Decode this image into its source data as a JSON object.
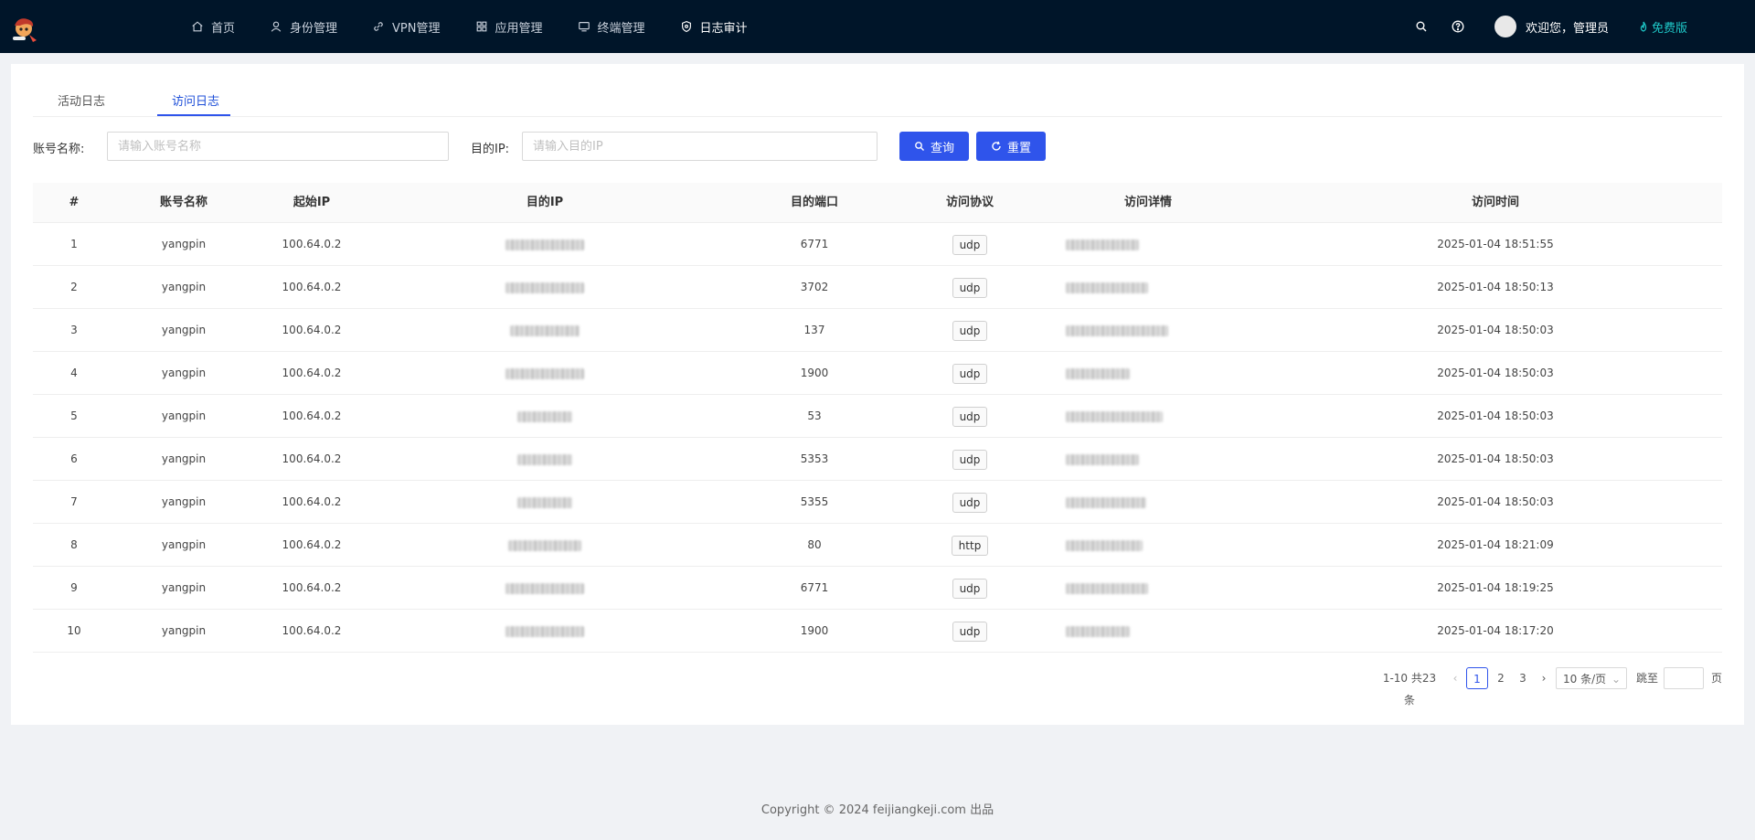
{
  "nav": {
    "items": [
      {
        "label": "首页",
        "icon": "home-icon"
      },
      {
        "label": "身份管理",
        "icon": "user-icon"
      },
      {
        "label": "VPN管理",
        "icon": "link-icon"
      },
      {
        "label": "应用管理",
        "icon": "apps-icon"
      },
      {
        "label": "终端管理",
        "icon": "monitor-icon"
      },
      {
        "label": "日志审计",
        "icon": "shield-icon",
        "active": true
      }
    ],
    "user_greeting": "欢迎您，管理员",
    "plan_label": "免费版"
  },
  "tabs": [
    "活动日志",
    "访问日志"
  ],
  "active_tab": "访问日志",
  "filters": {
    "account_label": "账号名称:",
    "account_placeholder": "请输入账号名称",
    "ip_label": "目的IP:",
    "ip_placeholder": "请输入目的IP",
    "search_label": "查询",
    "reset_label": "重置"
  },
  "table": {
    "columns": [
      "#",
      "账号名称",
      "起始IP",
      "目的IP",
      "目的端口",
      "访问协议",
      "访问详情",
      "访问时间"
    ],
    "rows": [
      {
        "no": "1",
        "account": "yangpin",
        "src": "100.64.0.2",
        "port": "6771",
        "proto": "udp",
        "time": "2025-01-04 18:51:55"
      },
      {
        "no": "2",
        "account": "yangpin",
        "src": "100.64.0.2",
        "port": "3702",
        "proto": "udp",
        "time": "2025-01-04 18:50:13"
      },
      {
        "no": "3",
        "account": "yangpin",
        "src": "100.64.0.2",
        "port": "137",
        "proto": "udp",
        "time": "2025-01-04 18:50:03"
      },
      {
        "no": "4",
        "account": "yangpin",
        "src": "100.64.0.2",
        "port": "1900",
        "proto": "udp",
        "time": "2025-01-04 18:50:03"
      },
      {
        "no": "5",
        "account": "yangpin",
        "src": "100.64.0.2",
        "port": "53",
        "proto": "udp",
        "time": "2025-01-04 18:50:03"
      },
      {
        "no": "6",
        "account": "yangpin",
        "src": "100.64.0.2",
        "port": "5353",
        "proto": "udp",
        "time": "2025-01-04 18:50:03"
      },
      {
        "no": "7",
        "account": "yangpin",
        "src": "100.64.0.2",
        "port": "5355",
        "proto": "udp",
        "time": "2025-01-04 18:50:03"
      },
      {
        "no": "8",
        "account": "yangpin",
        "src": "100.64.0.2",
        "port": "80",
        "proto": "http",
        "time": "2025-01-04 18:21:09"
      },
      {
        "no": "9",
        "account": "yangpin",
        "src": "100.64.0.2",
        "port": "6771",
        "proto": "udp",
        "time": "2025-01-04 18:19:25"
      },
      {
        "no": "10",
        "account": "yangpin",
        "src": "100.64.0.2",
        "port": "1900",
        "proto": "udp",
        "time": "2025-01-04 18:17:20"
      }
    ]
  },
  "pagination": {
    "summary": "1-10 共23条",
    "pages": [
      "1",
      "2",
      "3"
    ],
    "current": "1",
    "page_size": "10 条/页",
    "jump_label": "跳至",
    "page_suffix": "页"
  },
  "footer": "Copyright © 2024 feijiangkeji.com 出品",
  "colors": {
    "header": "#001529",
    "primary": "#2f54eb",
    "plan": "#1ec8c8"
  }
}
